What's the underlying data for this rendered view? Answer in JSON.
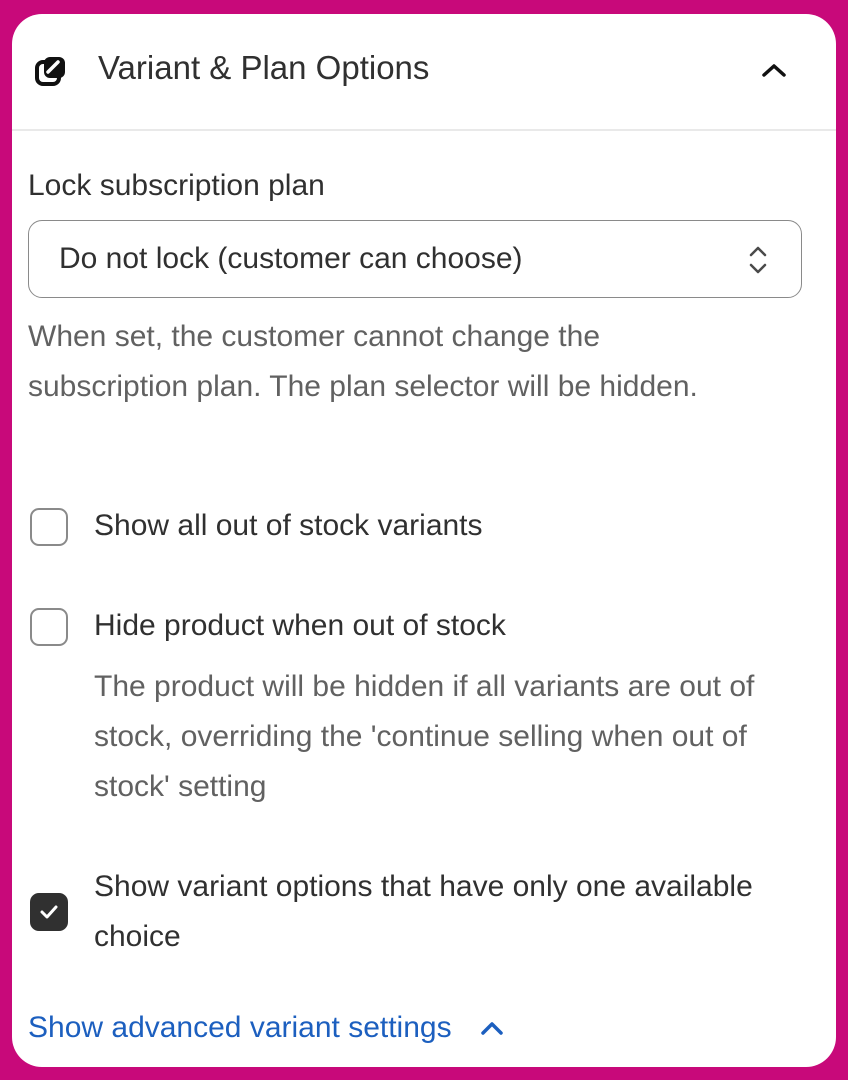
{
  "header": {
    "title": "Variant & Plan Options",
    "icon": "variant-icon",
    "collapse_icon": "chevron-up-icon"
  },
  "lock_plan": {
    "label": "Lock subscription plan",
    "selected": "Do not lock (customer can choose)",
    "help": "When set, the customer cannot change the subscription plan. The plan selector will be hidden."
  },
  "options": [
    {
      "label": "Show all out of stock variants",
      "checked": false
    },
    {
      "label": "Hide product when out of stock",
      "checked": false,
      "help": "The product will be hidden if all variants are out of stock, overriding the 'continue selling when out of stock' setting"
    },
    {
      "label": "Show variant options that have only one available choice",
      "checked": true
    }
  ],
  "advanced": {
    "label": "Show advanced variant settings"
  },
  "colors": {
    "frame": "#c8097a",
    "link": "#1c5fbf",
    "text": "#303030",
    "muted": "#616161"
  }
}
